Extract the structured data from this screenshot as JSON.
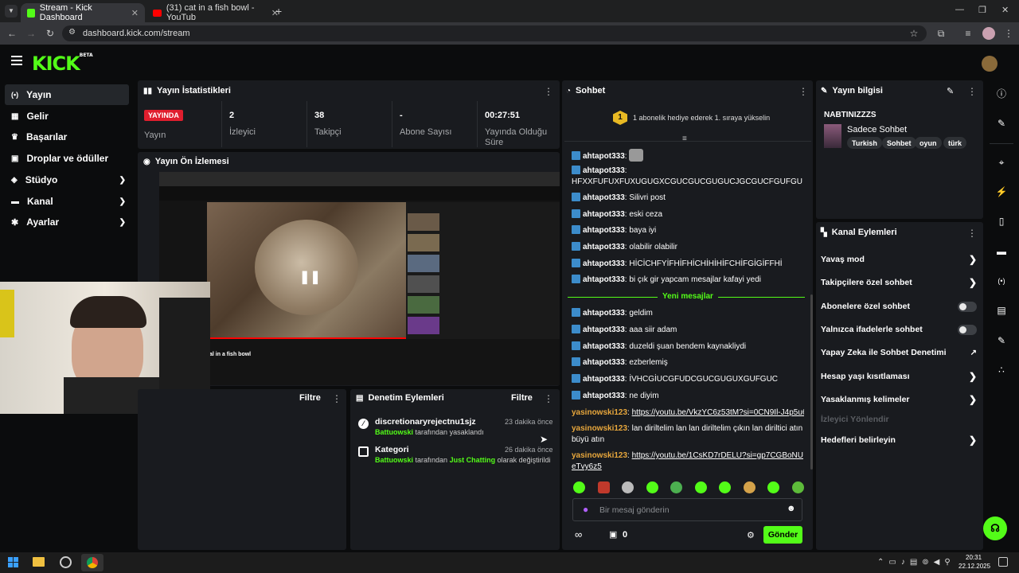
{
  "browser": {
    "tabs": [
      {
        "title": "Stream - Kick Dashboard",
        "active": true
      },
      {
        "title": "(31) cat in a fish bowl - YouTub",
        "active": false
      }
    ],
    "url": "dashboard.kick.com/stream"
  },
  "brand": {
    "logo": "KICK",
    "beta": "BETA",
    "accent": "#53fc18"
  },
  "sidebar": {
    "items": [
      {
        "label": "Yayın",
        "icon": "broadcast-icon",
        "active": true
      },
      {
        "label": "Gelir",
        "icon": "money-icon"
      },
      {
        "label": "Başarılar",
        "icon": "trophy-icon"
      },
      {
        "label": "Droplar ve ödüller",
        "icon": "gift-icon"
      },
      {
        "label": "Stüdyo",
        "icon": "studio-icon",
        "expandable": true
      },
      {
        "label": "Kanal",
        "icon": "channel-icon",
        "expandable": true
      },
      {
        "label": "Ayarlar",
        "icon": "gear-icon",
        "expandable": true
      }
    ]
  },
  "stats": {
    "title": "Yayın İstatistikleri",
    "live_badge": "YAYINDA",
    "items": [
      {
        "value": "",
        "label": "Yayın"
      },
      {
        "value": "2",
        "label": "İzleyici"
      },
      {
        "value": "38",
        "label": "Takipçi"
      },
      {
        "value": "-",
        "label": "Abone Sayısı"
      },
      {
        "value": "00:27:51",
        "label": "Yayında Olduğu Süre"
      }
    ]
  },
  "preview": {
    "title": "Yayın Ön İzlemesi",
    "video_title": "al in a fish bowl"
  },
  "filter_panel": {
    "filter_label": "Filtre"
  },
  "moderation": {
    "title": "Denetim Eylemleri",
    "filter_label": "Filtre",
    "items": [
      {
        "title": "discretionaryrejectnu1sjz",
        "time": "23 dakika önce",
        "actor": "Battuowski",
        "text": "tarafından yasaklandı",
        "extra": "",
        "extra2": ""
      },
      {
        "title": "Kategori",
        "time": "26 dakika önce",
        "actor": "Battuowski",
        "text": "tarafından",
        "extra": "Just Chatting",
        "extra2": "olarak değiştirildi"
      }
    ]
  },
  "chat": {
    "title": "Sohbet",
    "gift_rank": "1",
    "gift_text": "1 abonelik hediye ederek 1. sıraya yükselin",
    "new_messages": "Yeni mesajlar",
    "messages": [
      {
        "user": "ahtapot333",
        "text": ""
      },
      {
        "user": "ahtapot333",
        "text": "HFXXFUFUXFUXUGUGXCGUCGUCGUGUCJGCGUCFGUFGU"
      },
      {
        "user": "ahtapot333",
        "text": "Silivri post"
      },
      {
        "user": "ahtapot333",
        "text": "eski ceza"
      },
      {
        "user": "ahtapot333",
        "text": "baya iyi"
      },
      {
        "user": "ahtapot333",
        "text": "olabilir olabilir"
      },
      {
        "user": "ahtapot333",
        "text": "HİCİCHFYİFHİFHİCHİHİHİFCHİFGİGİFFHİ"
      },
      {
        "user": "ahtapot333",
        "text": "bi çık gir yapcam mesajlar kafayi yedi"
      },
      {
        "user": "ahtapot333",
        "text": "geldim"
      },
      {
        "user": "ahtapot333",
        "text": "aaa siir adam"
      },
      {
        "user": "ahtapot333",
        "text": "duzeldi şuan bendem kaynakliydi"
      },
      {
        "user": "ahtapot333",
        "text": "ezberlemiş"
      },
      {
        "user": "ahtapot333",
        "text": "İVHCGİUCGFUDCGUCGUGUXGUFGUC"
      },
      {
        "user": "ahtapot333",
        "text": "ne diyim"
      },
      {
        "user": "yasinowski123",
        "text": "https://youtu.be/VkzYC6z53tM?si=0CN9Il-J4p5u6lhh"
      },
      {
        "user": "yasinowski123",
        "text": "lan diriltelim lan lan diriltelim çıkın lan diriltici atın büyü atın"
      },
      {
        "user": "yasinowski123",
        "text": "https://youtu.be/1CsKD7rDELU?si=gp7CGBoNUeTvy6z5"
      }
    ],
    "input_placeholder": "Bir mesaj gönderin",
    "gift_count": "0",
    "send_label": "Gönder"
  },
  "stream_info": {
    "title": "Yayın bilgisi",
    "stream_title": "NABTINIZZZS",
    "category": "Sadece Sohbet",
    "tags": [
      "Turkish",
      "Sohbet",
      "oyun",
      "türk"
    ]
  },
  "channel_actions": {
    "title": "Kanal Eylemleri",
    "items": [
      {
        "label": "Yavaş mod",
        "control": "arrow"
      },
      {
        "label": "Takipçilere özel sohbet",
        "control": "arrow"
      },
      {
        "label": "Abonelere özel sohbet",
        "control": "toggle"
      },
      {
        "label": "Yalnızca ifadelerle sohbet",
        "control": "toggle"
      },
      {
        "label": "Yapay Zeka ile Sohbet Denetimi",
        "control": "external"
      },
      {
        "label": "Hesap yaşı kısıtlaması",
        "control": "arrow"
      },
      {
        "label": "Yasaklanmış kelimeler",
        "control": "arrow"
      },
      {
        "label": "İzleyici Yönlendir",
        "control": "disabled"
      },
      {
        "label": "Hedefleri belirleyin",
        "control": "arrow"
      }
    ]
  },
  "taskbar": {
    "time": "20:31",
    "date": "22.12.2025"
  }
}
